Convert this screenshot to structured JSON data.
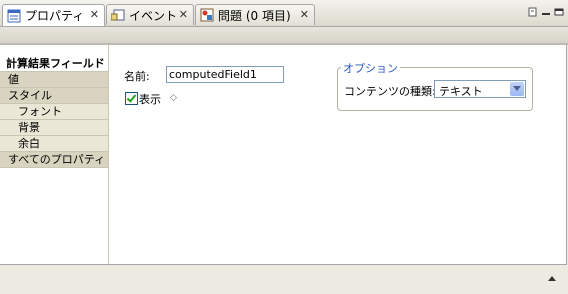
{
  "tabs": [
    {
      "label": "プロパティ",
      "icon": "properties-icon",
      "active": true
    },
    {
      "label": "イベント",
      "icon": "events-icon",
      "active": false
    },
    {
      "label": "問題 (0 項目)",
      "icon": "problems-icon",
      "active": false
    }
  ],
  "tab_close_glyph": "✕",
  "nav": {
    "title": "計算結果フィールド",
    "items": [
      {
        "label": "値",
        "type": "group"
      },
      {
        "label": "スタイル",
        "type": "group"
      },
      {
        "label": "フォント",
        "type": "sub"
      },
      {
        "label": "背景",
        "type": "sub"
      },
      {
        "label": "余白",
        "type": "sub"
      },
      {
        "label": "すべてのプロパティ",
        "type": "group"
      }
    ]
  },
  "form": {
    "name_label": "名前:",
    "name_value": "computedField1",
    "visible_label": "表示",
    "visible_checked": true,
    "diamond": "◇"
  },
  "options": {
    "legend": "オプション",
    "content_type_label": "コンテンツの種類:",
    "content_type_value": "テキスト"
  },
  "colors": {
    "accent_legend": "#2b56b8",
    "check_green": "#21a121"
  }
}
